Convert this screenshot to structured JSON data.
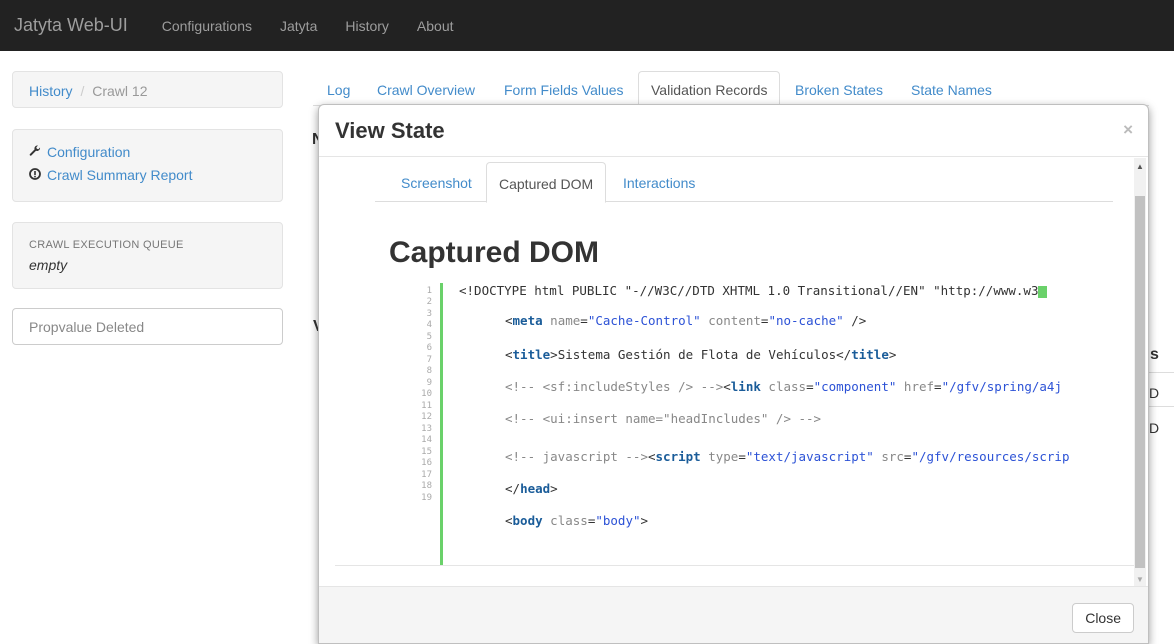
{
  "navbar": {
    "brand": "Jatyta Web-UI",
    "links": [
      "Configurations",
      "Jatyta",
      "History",
      "About"
    ]
  },
  "sidebar": {
    "breadcrumb": {
      "history": "History",
      "sep": "/",
      "current": "Crawl 12"
    },
    "links": [
      {
        "icon": "wrench-icon",
        "label": "Configuration"
      },
      {
        "icon": "info-circle-icon",
        "label": "Crawl Summary Report"
      }
    ],
    "queue": {
      "heading": "CRAWL EXECUTION QUEUE",
      "value": "empty"
    },
    "prop_button": "Propvalue Deleted"
  },
  "tabs": [
    "Log",
    "Crawl Overview",
    "Form Fields Values",
    "Validation Records",
    "Broken States",
    "State Names"
  ],
  "tabs_active": "Validation Records",
  "background": {
    "n": "N",
    "v": "V",
    "s": "s",
    "d1": "D",
    "d2": "D"
  },
  "modal": {
    "title": "View State",
    "close_x": "×",
    "tabs": [
      "Screenshot",
      "Captured DOM",
      "Interactions"
    ],
    "active_tab": "Captured DOM",
    "heading": "Captured DOM",
    "code": {
      "l1": "<!DOCTYPE html PUBLIC \"-//W3C//DTD XHTML 1.0 Transitional//EN\" \"http://www.w3",
      "l3_tag": "meta",
      "l3_a1": "name",
      "l3_v1": "\"Cache-Control\"",
      "l3_a2": "content",
      "l3_v2": "\"no-cache\"",
      "l6_text": "Sistema Gestión de Flota de Vehículos",
      "l6_tag": "title",
      "l8_cmt": "<!-- <sf:includeStyles />  -->",
      "l8_tag": "link",
      "l8_a1": "class",
      "l8_v1": "\"component\"",
      "l8_a2": "href",
      "l8_v2": "\"/gfv/spring/a4j",
      "l10_cmt": "<!-- <ui:insert name=\"headIncludes\" />  -->",
      "l13_cmt": "<!-- javascript -->",
      "l13_tag": "script",
      "l13_a1": "type",
      "l13_v1": "\"text/javascript\"",
      "l13_a2": "src",
      "l13_v2": "\"/gfv/resources/scrip",
      "l15_tag": "head",
      "l17_tag": "body",
      "l17_a1": "class",
      "l17_v1": "\"body\""
    },
    "line_numbers": [
      "1",
      "2",
      "3",
      "4",
      "5",
      "6",
      "7",
      "8",
      "9",
      "10",
      "11",
      "12",
      "13",
      "14",
      "15",
      "16",
      "17",
      "18",
      "19"
    ],
    "close_button": "Close"
  }
}
